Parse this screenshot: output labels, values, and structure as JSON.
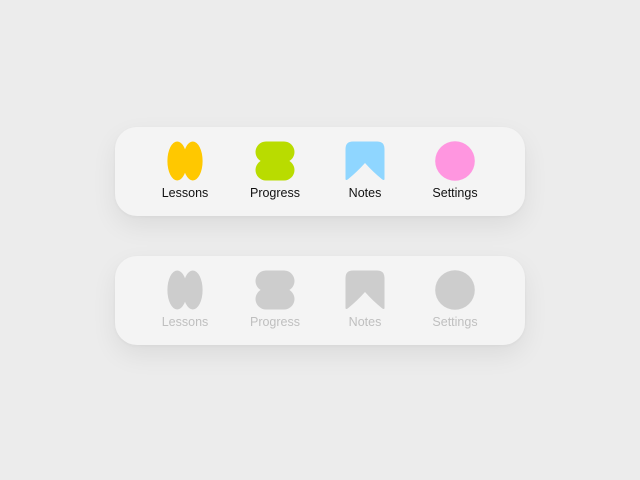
{
  "colors": {
    "background": "#ececec",
    "bar": "#f4f4f4",
    "lessons": "#ffc800",
    "progress": "#b9dc00",
    "notes": "#8fd6ff",
    "settings": "#ff96e0",
    "disabled_icon": "#cdcdcd",
    "disabled_label": "#bfbfbf",
    "active_label": "#111111"
  },
  "active_bar": {
    "tabs": [
      {
        "label": "Lessons",
        "icon": "lessons-icon"
      },
      {
        "label": "Progress",
        "icon": "progress-icon"
      },
      {
        "label": "Notes",
        "icon": "notes-icon"
      },
      {
        "label": "Settings",
        "icon": "settings-icon"
      }
    ]
  },
  "disabled_bar": {
    "tabs": [
      {
        "label": "Lessons",
        "icon": "lessons-icon"
      },
      {
        "label": "Progress",
        "icon": "progress-icon"
      },
      {
        "label": "Notes",
        "icon": "notes-icon"
      },
      {
        "label": "Settings",
        "icon": "settings-icon"
      }
    ]
  }
}
